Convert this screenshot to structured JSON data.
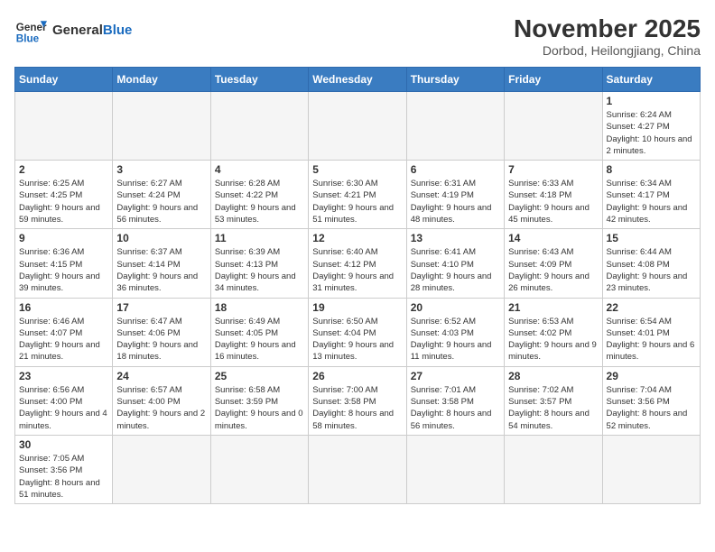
{
  "logo": {
    "text_general": "General",
    "text_blue": "Blue"
  },
  "title": "November 2025",
  "subtitle": "Dorbod, Heilongjiang, China",
  "weekdays": [
    "Sunday",
    "Monday",
    "Tuesday",
    "Wednesday",
    "Thursday",
    "Friday",
    "Saturday"
  ],
  "weeks": [
    [
      {
        "day": "",
        "info": ""
      },
      {
        "day": "",
        "info": ""
      },
      {
        "day": "",
        "info": ""
      },
      {
        "day": "",
        "info": ""
      },
      {
        "day": "",
        "info": ""
      },
      {
        "day": "",
        "info": ""
      },
      {
        "day": "1",
        "info": "Sunrise: 6:24 AM\nSunset: 4:27 PM\nDaylight: 10 hours and 2 minutes."
      }
    ],
    [
      {
        "day": "2",
        "info": "Sunrise: 6:25 AM\nSunset: 4:25 PM\nDaylight: 9 hours and 59 minutes."
      },
      {
        "day": "3",
        "info": "Sunrise: 6:27 AM\nSunset: 4:24 PM\nDaylight: 9 hours and 56 minutes."
      },
      {
        "day": "4",
        "info": "Sunrise: 6:28 AM\nSunset: 4:22 PM\nDaylight: 9 hours and 53 minutes."
      },
      {
        "day": "5",
        "info": "Sunrise: 6:30 AM\nSunset: 4:21 PM\nDaylight: 9 hours and 51 minutes."
      },
      {
        "day": "6",
        "info": "Sunrise: 6:31 AM\nSunset: 4:19 PM\nDaylight: 9 hours and 48 minutes."
      },
      {
        "day": "7",
        "info": "Sunrise: 6:33 AM\nSunset: 4:18 PM\nDaylight: 9 hours and 45 minutes."
      },
      {
        "day": "8",
        "info": "Sunrise: 6:34 AM\nSunset: 4:17 PM\nDaylight: 9 hours and 42 minutes."
      }
    ],
    [
      {
        "day": "9",
        "info": "Sunrise: 6:36 AM\nSunset: 4:15 PM\nDaylight: 9 hours and 39 minutes."
      },
      {
        "day": "10",
        "info": "Sunrise: 6:37 AM\nSunset: 4:14 PM\nDaylight: 9 hours and 36 minutes."
      },
      {
        "day": "11",
        "info": "Sunrise: 6:39 AM\nSunset: 4:13 PM\nDaylight: 9 hours and 34 minutes."
      },
      {
        "day": "12",
        "info": "Sunrise: 6:40 AM\nSunset: 4:12 PM\nDaylight: 9 hours and 31 minutes."
      },
      {
        "day": "13",
        "info": "Sunrise: 6:41 AM\nSunset: 4:10 PM\nDaylight: 9 hours and 28 minutes."
      },
      {
        "day": "14",
        "info": "Sunrise: 6:43 AM\nSunset: 4:09 PM\nDaylight: 9 hours and 26 minutes."
      },
      {
        "day": "15",
        "info": "Sunrise: 6:44 AM\nSunset: 4:08 PM\nDaylight: 9 hours and 23 minutes."
      }
    ],
    [
      {
        "day": "16",
        "info": "Sunrise: 6:46 AM\nSunset: 4:07 PM\nDaylight: 9 hours and 21 minutes."
      },
      {
        "day": "17",
        "info": "Sunrise: 6:47 AM\nSunset: 4:06 PM\nDaylight: 9 hours and 18 minutes."
      },
      {
        "day": "18",
        "info": "Sunrise: 6:49 AM\nSunset: 4:05 PM\nDaylight: 9 hours and 16 minutes."
      },
      {
        "day": "19",
        "info": "Sunrise: 6:50 AM\nSunset: 4:04 PM\nDaylight: 9 hours and 13 minutes."
      },
      {
        "day": "20",
        "info": "Sunrise: 6:52 AM\nSunset: 4:03 PM\nDaylight: 9 hours and 11 minutes."
      },
      {
        "day": "21",
        "info": "Sunrise: 6:53 AM\nSunset: 4:02 PM\nDaylight: 9 hours and 9 minutes."
      },
      {
        "day": "22",
        "info": "Sunrise: 6:54 AM\nSunset: 4:01 PM\nDaylight: 9 hours and 6 minutes."
      }
    ],
    [
      {
        "day": "23",
        "info": "Sunrise: 6:56 AM\nSunset: 4:00 PM\nDaylight: 9 hours and 4 minutes."
      },
      {
        "day": "24",
        "info": "Sunrise: 6:57 AM\nSunset: 4:00 PM\nDaylight: 9 hours and 2 minutes."
      },
      {
        "day": "25",
        "info": "Sunrise: 6:58 AM\nSunset: 3:59 PM\nDaylight: 9 hours and 0 minutes."
      },
      {
        "day": "26",
        "info": "Sunrise: 7:00 AM\nSunset: 3:58 PM\nDaylight: 8 hours and 58 minutes."
      },
      {
        "day": "27",
        "info": "Sunrise: 7:01 AM\nSunset: 3:58 PM\nDaylight: 8 hours and 56 minutes."
      },
      {
        "day": "28",
        "info": "Sunrise: 7:02 AM\nSunset: 3:57 PM\nDaylight: 8 hours and 54 minutes."
      },
      {
        "day": "29",
        "info": "Sunrise: 7:04 AM\nSunset: 3:56 PM\nDaylight: 8 hours and 52 minutes."
      }
    ],
    [
      {
        "day": "30",
        "info": "Sunrise: 7:05 AM\nSunset: 3:56 PM\nDaylight: 8 hours and 51 minutes."
      },
      {
        "day": "",
        "info": ""
      },
      {
        "day": "",
        "info": ""
      },
      {
        "day": "",
        "info": ""
      },
      {
        "day": "",
        "info": ""
      },
      {
        "day": "",
        "info": ""
      },
      {
        "day": "",
        "info": ""
      }
    ]
  ]
}
